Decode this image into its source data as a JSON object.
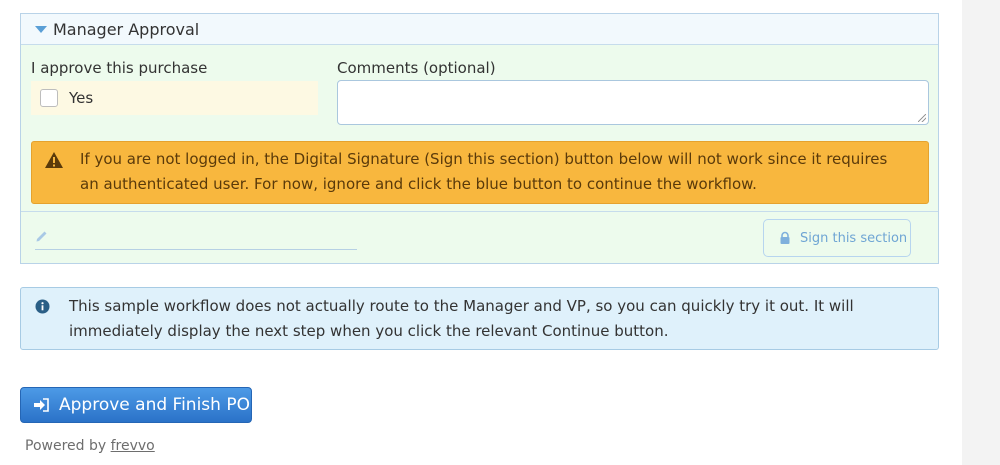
{
  "section": {
    "title": "Manager Approval",
    "approve_label": "I approve this purchase",
    "yes_label": "Yes",
    "comments_label": "Comments (optional)",
    "comments_value": "",
    "warning_text": "If you are not logged in, the Digital Signature (Sign this section) button below will not work since it requires an authenticated user. For now, ignore and click the blue button to continue the workflow.",
    "sign_button_label": "Sign this section"
  },
  "info": {
    "text": "This sample workflow does not actually route to the Manager and VP, so you can quickly try it out. It will immediately display the next step when you click the relevant Continue button."
  },
  "actions": {
    "finish_label": "Approve and Finish PO"
  },
  "footer": {
    "powered_by": "Powered by",
    "link_text": "frevvo"
  },
  "icons": {
    "collapse": "triangle-down-icon",
    "warning": "warning-icon",
    "pencil": "pencil-icon",
    "lock": "lock-icon",
    "info": "info-icon",
    "finish": "sign-in-icon"
  },
  "colors": {
    "section_bg": "#edfbed",
    "warning_bg": "#f8b73e",
    "info_bg": "#dff1fb",
    "button_bg": "#3584d8",
    "accent": "#5a9fd6"
  }
}
